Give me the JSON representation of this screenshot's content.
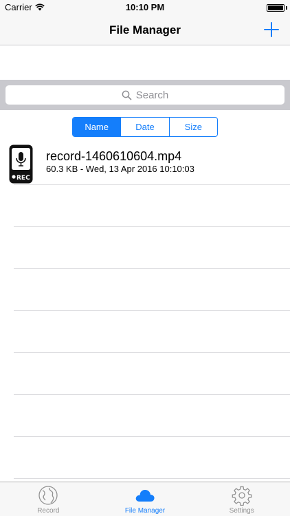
{
  "status_bar": {
    "carrier": "Carrier",
    "time": "10:10 PM",
    "wifi_icon": "wifi-icon",
    "battery_icon": "battery-icon"
  },
  "nav_bar": {
    "title": "File Manager",
    "add_icon": "plus-icon"
  },
  "search": {
    "placeholder": "Search",
    "icon": "search-icon"
  },
  "sort_segments": [
    {
      "label": "Name",
      "selected": true
    },
    {
      "label": "Date",
      "selected": false
    },
    {
      "label": "Size",
      "selected": false
    }
  ],
  "files": [
    {
      "name": "record-1460610604.mp4",
      "meta": "60.3 KB - Wed, 13 Apr 2016 10:10:03",
      "icon": "recorder-icon",
      "icon_text": "REC"
    }
  ],
  "tab_bar": {
    "items": [
      {
        "label": "Record",
        "icon": "globe-icon",
        "active": false
      },
      {
        "label": "File Manager",
        "icon": "cloud-icon",
        "active": true
      },
      {
        "label": "Settings",
        "icon": "gear-icon",
        "active": false
      }
    ]
  },
  "colors": {
    "accent": "#147efb",
    "inactive_tab": "#929292",
    "search_bar_bg": "#c9c9ce"
  }
}
